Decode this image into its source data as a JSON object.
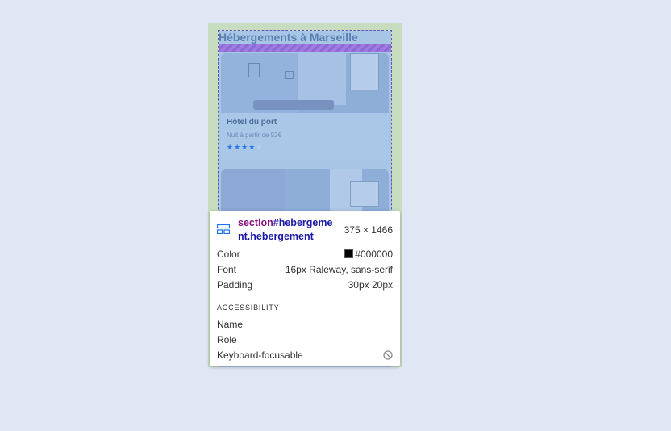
{
  "page": {
    "heading": "Hébergements à Marseille"
  },
  "cards": [
    {
      "title": "Hôtel du port",
      "subtitle": "Nuit à partir de 52€",
      "rating": 4,
      "max_rating": 5
    }
  ],
  "inspector": {
    "tag": "section",
    "id_class": "#hebergement.hebergement",
    "size": "375 × 1466",
    "rows": [
      {
        "label": "Color",
        "value": "#000000",
        "swatch": "#000000"
      },
      {
        "label": "Font",
        "value": "16px Raleway, sans-serif"
      },
      {
        "label": "Padding",
        "value": "30px 20px"
      }
    ],
    "accessibility_title": "ACCESSIBILITY",
    "accessibility_rows": [
      {
        "label": "Name",
        "value": ""
      },
      {
        "label": "Role",
        "value": ""
      },
      {
        "label": "Keyboard-focusable",
        "icon": "not-allowed-icon"
      }
    ]
  },
  "colors": {
    "page_bg": "#e0e6f4",
    "margin_overlay": "#c8ddc0",
    "content_overlay": "#a7c6e6",
    "star_active": "#2f74e4",
    "tag_color": "#881280",
    "class_color": "#1a1aa6"
  }
}
